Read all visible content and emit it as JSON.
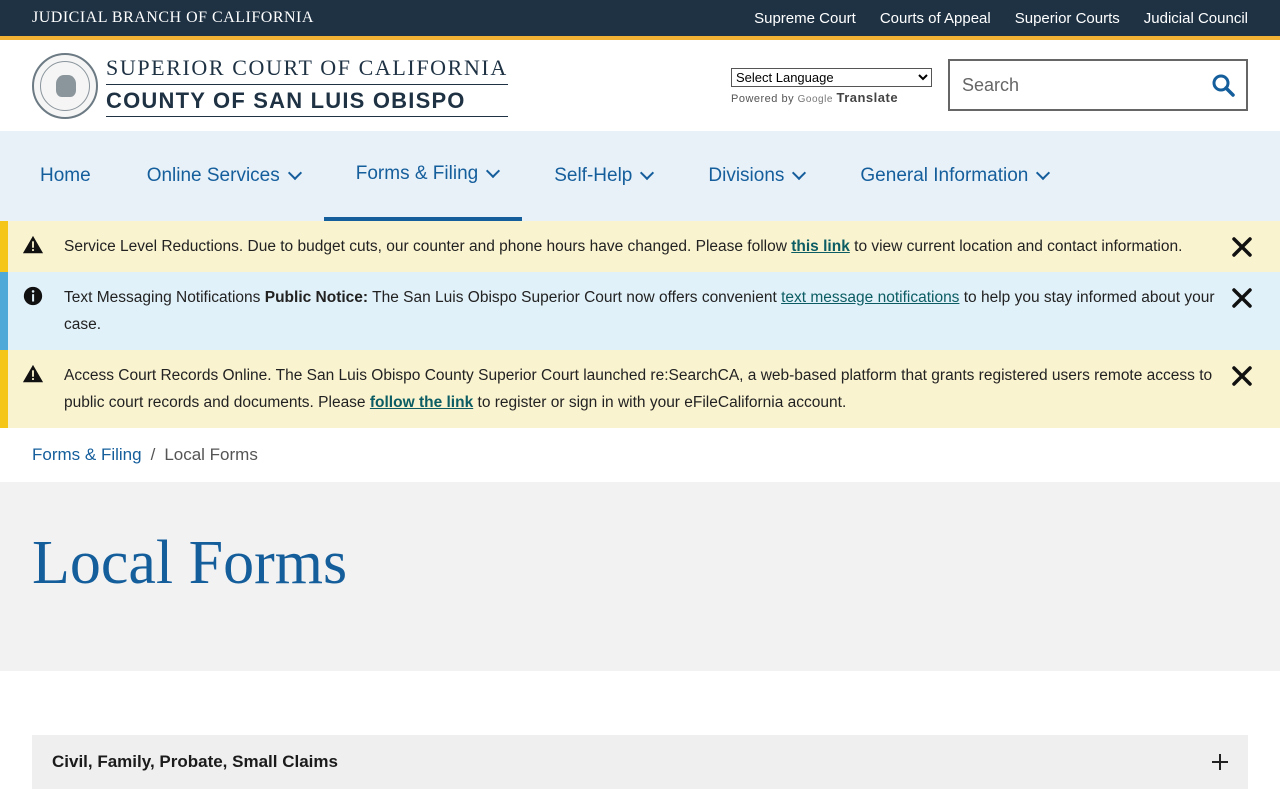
{
  "topbar": {
    "branch": "JUDICIAL BRANCH OF CALIFORNIA",
    "links": [
      "Supreme Court",
      "Courts of Appeal",
      "Superior Courts",
      "Judicial Council"
    ]
  },
  "header": {
    "line1": "SUPERIOR COURT OF CALIFORNIA",
    "line2": "COUNTY OF SAN LUIS OBISPO",
    "seal_icon": "court-seal-icon"
  },
  "translate": {
    "select_label": "Select Language",
    "powered_by": "Powered by",
    "google": "Google",
    "translate": "Translate"
  },
  "search": {
    "placeholder": "Search",
    "icon": "search-icon"
  },
  "nav": {
    "items": [
      {
        "label": "Home",
        "has_menu": false
      },
      {
        "label": "Online Services",
        "has_menu": true
      },
      {
        "label": "Forms & Filing",
        "has_menu": true,
        "active": true
      },
      {
        "label": "Self-Help",
        "has_menu": true
      },
      {
        "label": "Divisions",
        "has_menu": true
      },
      {
        "label": "General Information",
        "has_menu": true
      }
    ]
  },
  "alerts": [
    {
      "type": "warning",
      "text_before": "Service Level Reductions. Due to budget cuts, our counter and phone hours have changed. Please follow ",
      "link": "this link",
      "text_after": " to view current location and contact information."
    },
    {
      "type": "info",
      "title": "Text Messaging Notifications ",
      "bold": "Public Notice:",
      "text_before": " The San Luis Obispo Superior Court now offers convenient ",
      "link": "text message notifications",
      "text_after": " to help you stay informed about your case."
    },
    {
      "type": "warning",
      "text_before": "Access Court Records Online. The San Luis Obispo County Superior Court launched re:SearchCA, a web-based platform that grants registered users remote access to public court records and documents. Please ",
      "link": "follow the link",
      "text_after": " to register or sign in with your eFileCalifornia account."
    }
  ],
  "breadcrumb": {
    "parent": "Forms & Filing",
    "separator": "/",
    "current": "Local Forms"
  },
  "page": {
    "title": "Local Forms"
  },
  "accordion": {
    "items": [
      "Civil, Family, Probate, Small Claims"
    ]
  },
  "colors": {
    "topbar": "#1e3244",
    "gold": "#f2b233",
    "brand_blue": "#155e9c",
    "nav_bg": "#e8f1f8",
    "warning_bg": "#faf3d0",
    "info_bg": "#e1f1f9"
  }
}
